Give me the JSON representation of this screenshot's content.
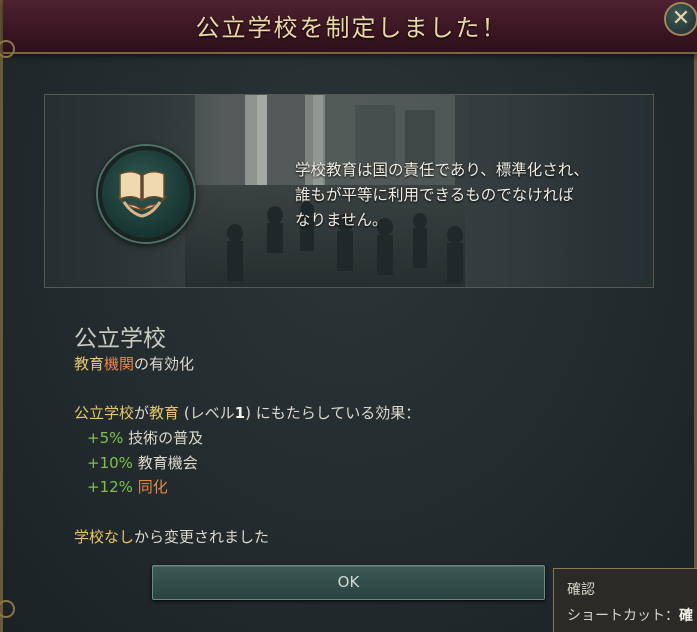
{
  "dialog": {
    "title": "公立学校を制定しました！",
    "close_glyph": "✕"
  },
  "event": {
    "flavor_lines": [
      "学校教育は国の責任であり、標準化され、",
      "誰もが平等に利用できるものでなければ",
      "なりません。"
    ]
  },
  "law": {
    "name": "公立学校",
    "subtitle_prefix": "教育",
    "subtitle_highlight": "機関",
    "subtitle_suffix": "の有効化",
    "effects_subject": "公立学校",
    "effects_connector": "が",
    "effects_target": "教育",
    "effects_level_prefix": " (レベル",
    "effects_level": "1",
    "effects_level_suffix": ") にもたらしている効果：",
    "effects": [
      {
        "value": "+5%",
        "label": "技術の普及",
        "highlight": false
      },
      {
        "value": "+10%",
        "label": "教育機会",
        "highlight": false
      },
      {
        "value": "+12%",
        "label": "同化",
        "highlight": true
      }
    ],
    "changed_prefix": "学校なし",
    "changed_suffix": "から変更されました"
  },
  "buttons": {
    "ok": "OK"
  },
  "tooltip": {
    "title": "確認",
    "shortcut_label": "ショートカット：",
    "shortcut_key": "確"
  },
  "colors": {
    "header": "#3a1522",
    "gold": "#e5c66a",
    "green": "#7ec24e",
    "orange": "#e08a4a",
    "button": "#2f4a46"
  },
  "icons": {
    "emblem": "open-book-in-hands-icon",
    "close": "close-icon"
  }
}
